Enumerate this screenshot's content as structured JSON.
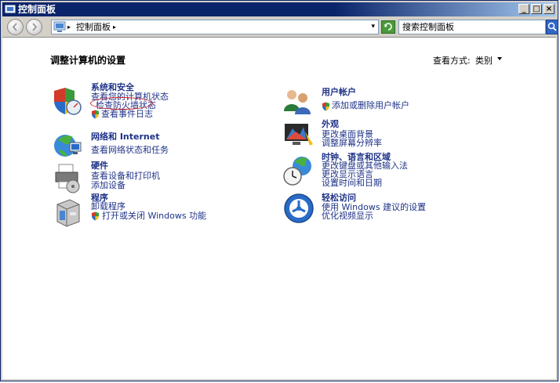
{
  "window": {
    "title": "控制面板"
  },
  "title_buttons": {
    "minimize": "_",
    "maximize": "□",
    "close": "×"
  },
  "toolbar": {
    "address_text": "控制面板",
    "address_dropdown": "▾",
    "search_placeholder": "搜索控制面板"
  },
  "main": {
    "heading": "调整计算机的设置",
    "view_by_label": "查看方式:",
    "view_by_value": "类别"
  },
  "categories": {
    "system": {
      "title": "系统和安全",
      "links": [
        "查看您的计算机状态",
        "检查防火墙状态",
        "查看事件日志"
      ]
    },
    "network": {
      "title": "网络和 Internet",
      "links": [
        "查看网络状态和任务"
      ]
    },
    "hardware": {
      "title": "硬件",
      "links": [
        "查看设备和打印机",
        "添加设备"
      ]
    },
    "programs": {
      "title": "程序",
      "links": [
        "卸载程序",
        "打开或关闭 Windows 功能"
      ]
    },
    "users": {
      "title": "用户帐户",
      "links": [
        "添加或删除用户帐户"
      ]
    },
    "appearance": {
      "title": "外观",
      "links": [
        "更改桌面背景",
        "调整屏幕分辨率"
      ]
    },
    "clock": {
      "title": "时钟、语言和区域",
      "links": [
        "更改键盘或其他输入法",
        "更改显示语言",
        "设置时间和日期"
      ]
    },
    "ease": {
      "title": "轻松访问",
      "links": [
        "使用 Windows 建议的设置",
        "优化视频显示"
      ]
    }
  },
  "colors": {
    "link": "#1e3287",
    "titlebar": "#0a246a",
    "annotation": "#d2232a"
  }
}
